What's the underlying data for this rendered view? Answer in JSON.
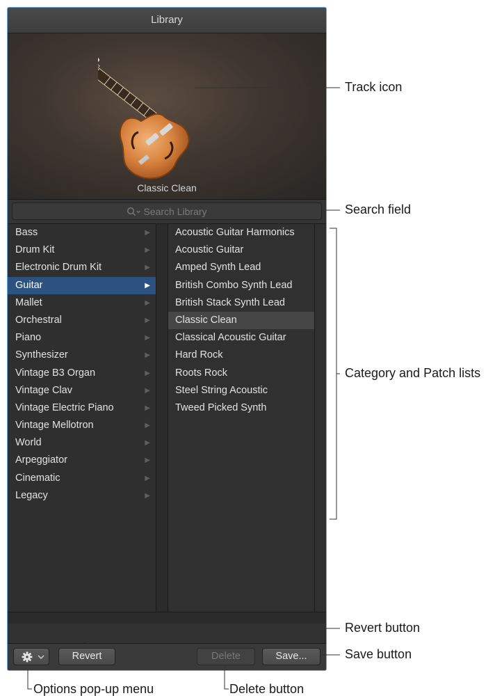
{
  "panel": {
    "title": "Library",
    "patch_name": "Classic Clean",
    "search_placeholder": "Search Library"
  },
  "categories": [
    {
      "label": "Bass"
    },
    {
      "label": "Drum Kit"
    },
    {
      "label": "Electronic Drum Kit"
    },
    {
      "label": "Guitar",
      "selected": true
    },
    {
      "label": "Mallet"
    },
    {
      "label": "Orchestral"
    },
    {
      "label": "Piano"
    },
    {
      "label": "Synthesizer"
    },
    {
      "label": "Vintage B3 Organ"
    },
    {
      "label": "Vintage Clav"
    },
    {
      "label": "Vintage Electric Piano"
    },
    {
      "label": "Vintage Mellotron"
    },
    {
      "label": "World"
    },
    {
      "label": "Arpeggiator"
    },
    {
      "label": "Cinematic"
    },
    {
      "label": "Legacy"
    }
  ],
  "patches": [
    {
      "label": "Acoustic Guitar Harmonics"
    },
    {
      "label": "Acoustic Guitar"
    },
    {
      "label": "Amped Synth Lead"
    },
    {
      "label": "British Combo Synth Lead"
    },
    {
      "label": "British Stack Synth Lead"
    },
    {
      "label": "Classic Clean",
      "selected": true
    },
    {
      "label": "Classical Acoustic Guitar"
    },
    {
      "label": "Hard Rock"
    },
    {
      "label": "Roots Rock"
    },
    {
      "label": "Steel String Acoustic"
    },
    {
      "label": "Tweed Picked Synth"
    }
  ],
  "toolbar": {
    "options_icon": "gear-icon",
    "revert_label": "Revert",
    "delete_label": "Delete",
    "delete_enabled": false,
    "save_label": "Save..."
  },
  "callouts": {
    "track_icon": "Track icon",
    "search_field": "Search field",
    "lists": "Category and Patch lists",
    "revert_button": "Revert button",
    "save_button": "Save button",
    "options_menu": "Options pop-up menu",
    "delete_button": "Delete button"
  },
  "colors": {
    "panel_bg": "#2d2d2d",
    "selection_blue": "#2c5282",
    "focus_border": "#6aa6d8"
  }
}
